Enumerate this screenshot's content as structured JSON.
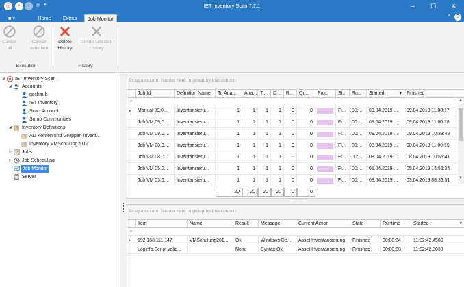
{
  "window": {
    "title": "IET Inventory Scan 7.7.1"
  },
  "menu": {
    "file_label": "■ ▾",
    "tabs": [
      "Home",
      "Extras",
      "Job Monitor"
    ],
    "active_tab": "Job Monitor"
  },
  "ribbon": {
    "buttons": [
      {
        "label": "Cancel\nall",
        "icon": "cancel-circle-icon",
        "enabled": false
      },
      {
        "label": "Cancel\nselection",
        "icon": "cancel-circle-icon",
        "enabled": false
      },
      {
        "label": "Delete\nHistory",
        "icon": "delete-x-icon",
        "enabled": true
      },
      {
        "label": "Delete selected\nHistory",
        "icon": "delete-x-icon",
        "enabled": false
      }
    ],
    "groups": [
      "Execution",
      "History"
    ]
  },
  "tree": {
    "nodes": [
      {
        "label": "IET Inventory Scan",
        "level": 0,
        "expanded": true,
        "icon": "app-logo-icon"
      },
      {
        "label": "Accounts",
        "level": 1,
        "expanded": true,
        "icon": "users-icon"
      },
      {
        "label": "gschaub",
        "level": 2,
        "icon": "user-icon"
      },
      {
        "label": "IET Inventory",
        "level": 2,
        "icon": "user-icon"
      },
      {
        "label": "Scan Account",
        "level": 2,
        "icon": "user-icon"
      },
      {
        "label": "Snmp Communities",
        "level": 2,
        "icon": "user-icon"
      },
      {
        "label": "Inventory Definitions",
        "level": 1,
        "expanded": true,
        "icon": "definitions-icon"
      },
      {
        "label": "AD Konten und Gruppen Invent...",
        "level": 2,
        "icon": "definition-icon"
      },
      {
        "label": "Inventory VMSchulung2012",
        "level": 2,
        "icon": "definition-icon"
      },
      {
        "label": "Jobs",
        "level": 1,
        "collapsed": true,
        "icon": "jobs-icon"
      },
      {
        "label": "Job Scheduling",
        "level": 1,
        "collapsed": true,
        "icon": "clock-icon"
      },
      {
        "label": "Job Monitor",
        "level": 1,
        "selected": true,
        "icon": "monitor-icon"
      },
      {
        "label": "Server",
        "level": 1,
        "icon": "server-icon"
      }
    ]
  },
  "jobs_grid": {
    "group_hint": "Drag a column header here to group by that column",
    "columns": [
      "Job Id",
      "Definition Name",
      "To Ana...",
      "Ana...",
      "T...",
      "D...",
      "R...",
      "Qu...",
      "Pro...",
      "St...",
      "Ru...",
      "Started",
      "Finished"
    ],
    "sort_indicator": "▾",
    "rows": [
      [
        "Manual 09.0...",
        "Inventarisieru...",
        "1",
        "1",
        "1",
        "1",
        "0",
        "0",
        "",
        "Fi...",
        "00:...",
        "09.04.2019 ...",
        "09.04.2019 11:03:17"
      ],
      [
        "Job VM 09.0...",
        "Inventarisieru...",
        "1",
        "1",
        "1",
        "1",
        "0",
        "0",
        "",
        "Fi...",
        "00:...",
        "09.04.2019 ...",
        "09.04.2019 11:00:18"
      ],
      [
        "Job VM 09.0...",
        "Inventarisieru...",
        "1",
        "1",
        "1",
        "1",
        "0",
        "0",
        "",
        "Fi...",
        "00:...",
        "09.04.2019 ...",
        "09.04.2019 10:33:48"
      ],
      [
        "Job VM 08.0...",
        "Inventarisieru...",
        "1",
        "1",
        "1",
        "1",
        "0",
        "0",
        "",
        "Fi...",
        "00:...",
        "08.04.2019 ...",
        "08.04.2019 11:00:15"
      ],
      [
        "Job VM 08.0...",
        "Inventarisieru...",
        "1",
        "1",
        "1",
        "1",
        "0",
        "0",
        "",
        "Fi...",
        "00:...",
        "08.04.2019 ...",
        "08.04.2019 10:55:41"
      ],
      [
        "Job VM 05.0...",
        "Inventarisieru...",
        "1",
        "1",
        "1",
        "1",
        "0",
        "0",
        "",
        "Fi...",
        "00:...",
        "05.04.2019 ...",
        "05.04.2019 14:56:34"
      ],
      [
        "Job VM 03.0...",
        "Inventarisieru...",
        "1",
        "1",
        "1",
        "1",
        "0",
        "0",
        "",
        "Fi...",
        "00:...",
        "03.04.2019 ...",
        "03.04.2019 08:36:51"
      ]
    ],
    "totals": [
      "20",
      "20",
      "20",
      "20",
      "0",
      "0"
    ],
    "progress_fill": 1.0
  },
  "detail_grid": {
    "group_hint": "Drag a column header here to group by that column",
    "columns": [
      "Item",
      "Name",
      "Result",
      "Message",
      "Current Action",
      "State",
      "Runtime",
      "Started"
    ],
    "rows": [
      [
        "192.168.111.147",
        "VMSchulung201...",
        "Ok",
        "Windows De...",
        "Asset Inventarisierung",
        "Finished",
        "00:00:34",
        "11:02:42.4500"
      ],
      [
        "Loginfo.Script valid...",
        "",
        "None",
        "Syntax Ok",
        "Asset Inventarisierung",
        "Finished",
        "00:00:00",
        "11:02:42.3030"
      ]
    ]
  },
  "colors": {
    "accent": "#2b78c5",
    "selection": "#3d8ee6",
    "progress": "#e5c2f0",
    "delete_red": "#e2492f"
  }
}
